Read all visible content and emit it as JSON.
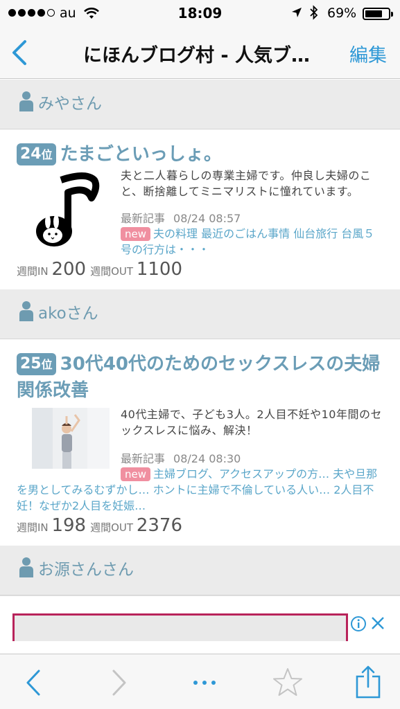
{
  "status_bar": {
    "carrier": "au",
    "time": "18:09",
    "battery": "69%",
    "battery_level": 0.69
  },
  "nav": {
    "back_icon": "chevron-left-icon",
    "title": "にほんブログ村 - 人気ブ…",
    "edit_label": "編集"
  },
  "entries": [
    {
      "author": "みやさん",
      "rank_number": "24",
      "rank_suffix": "位",
      "blog_title": "たまごといっしょ。",
      "thumbnail": "music-note-rabbit-image",
      "description": "夫と二人暮らしの専業主婦です。仲良し夫婦のこと、断捨離してミニマリストに憧れています。",
      "latest_label": "最新記事",
      "latest_date": "08/24 08:57",
      "new_badge": "new",
      "posts": "夫の料理 最近のごはん事情 仙台旅行 台風５号の行方は・・・",
      "in_label": "週間IN",
      "in_value": "200",
      "out_label": "週間OUT",
      "out_value": "1100"
    },
    {
      "author": "akoさん",
      "rank_number": "25",
      "rank_suffix": "位",
      "blog_title": "30代40代のためのセックスレスの夫婦関係改善",
      "thumbnail": "woman-stretching-photo",
      "description": "40代主婦で、子ども3人。2人目不妊や10年間のセックスレスに悩み、解決！",
      "latest_label": "最新記事",
      "latest_date": "08/24 08:30",
      "new_badge": "new",
      "posts": "主婦ブログ、アクセスアップの方… 夫や旦那を男としてみるむずかし… ホントに主婦で不倫している人い… 2人目不妊！なぜか2人目を妊娠…",
      "in_label": "週間IN",
      "in_value": "198",
      "out_label": "週間OUT",
      "out_value": "2376"
    }
  ],
  "third_author": "お源さんさん",
  "toolbar": {
    "back_icon": "back-arrow-icon",
    "forward_icon": "forward-arrow-icon",
    "more_icon": "more-dots-icon",
    "bookmark_icon": "star-icon",
    "share_icon": "share-icon"
  },
  "colors": {
    "accent": "#2e98d6",
    "rank": "#6b9db6",
    "link": "#5aa6c9",
    "new_badge": "#f08fa0"
  }
}
